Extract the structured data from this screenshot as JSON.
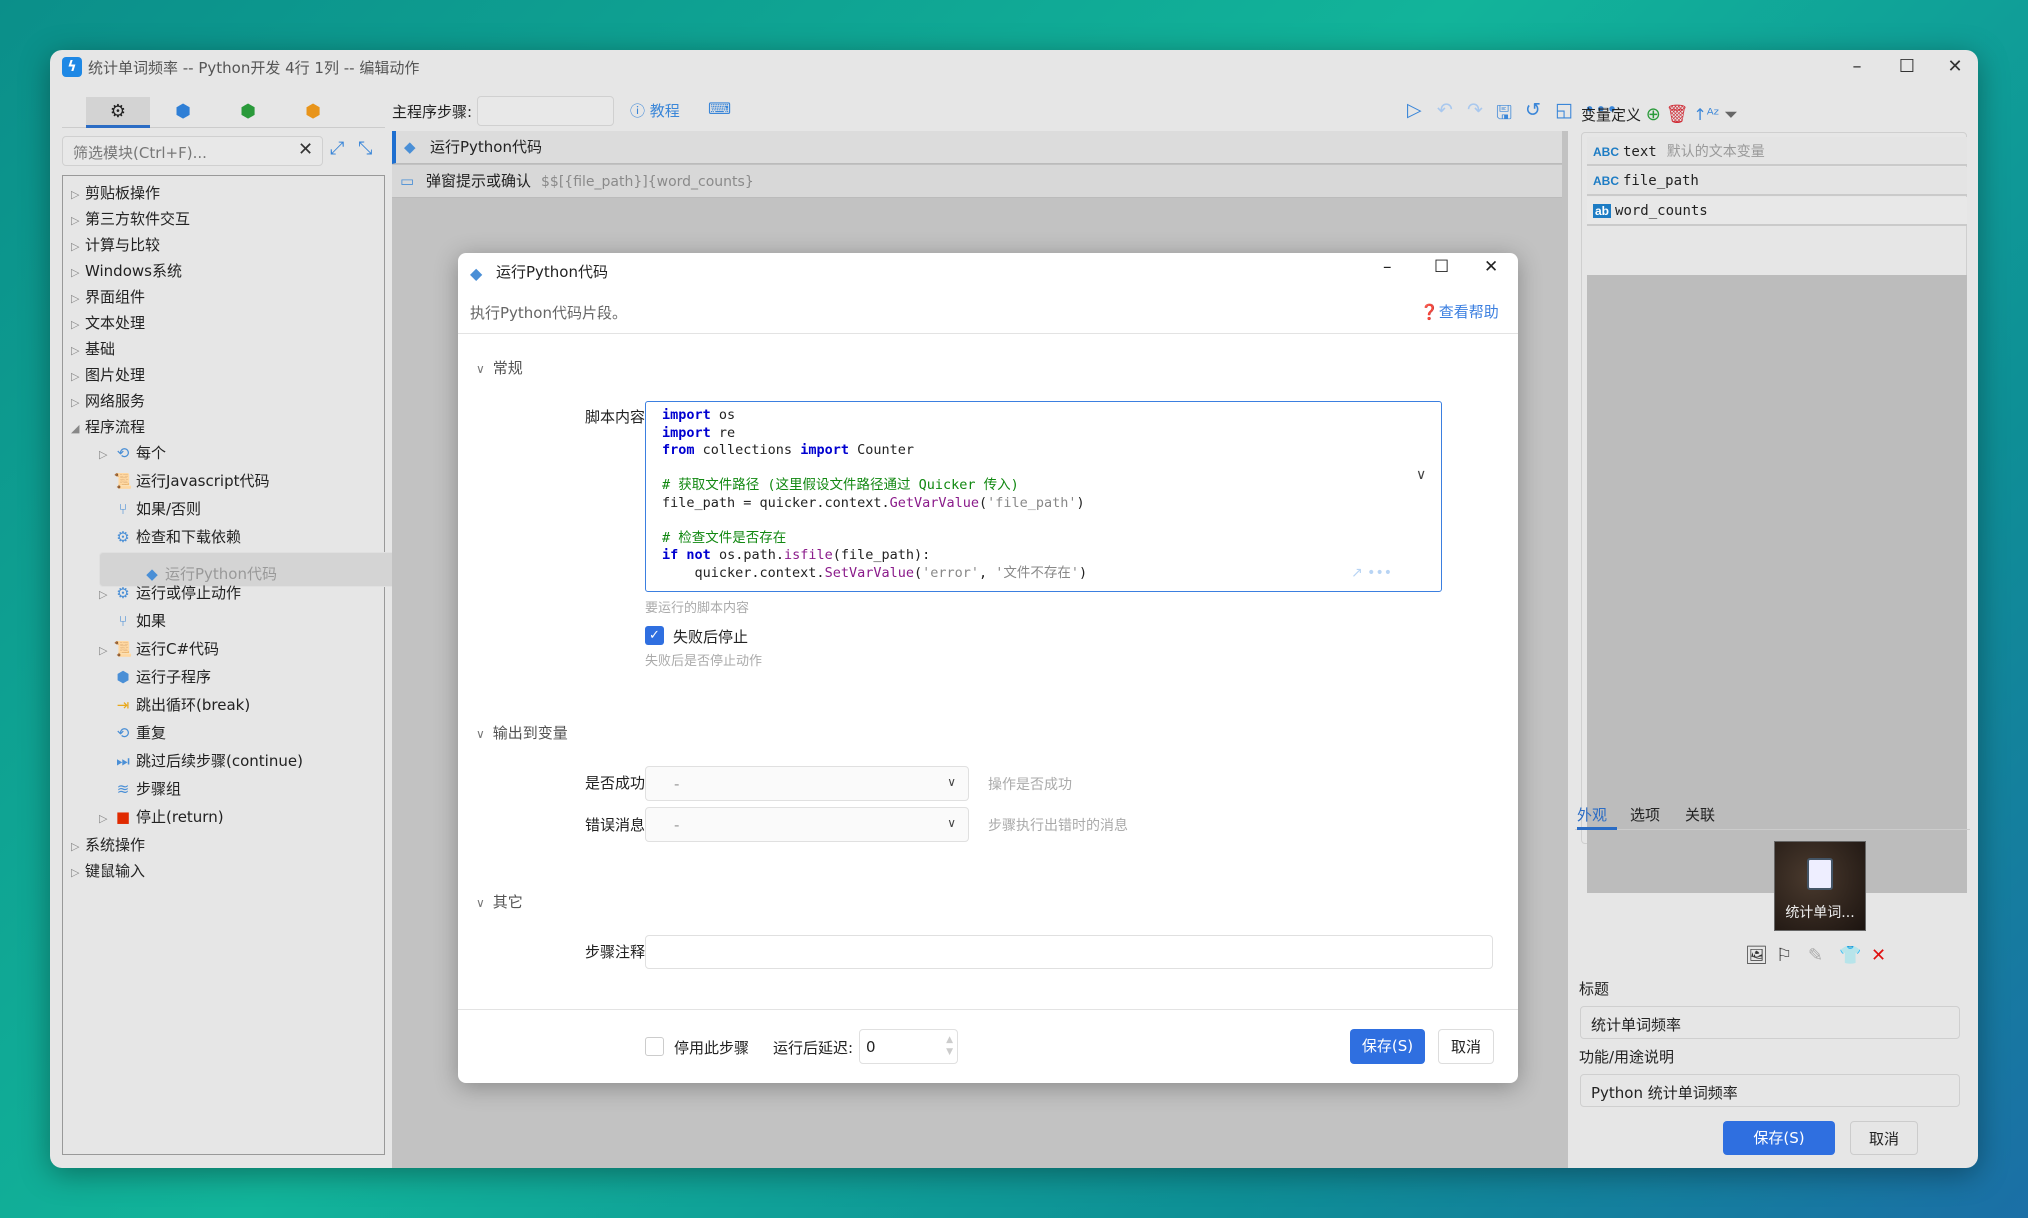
{
  "window": {
    "title": "统计单词频率 -- Python开发 4行 1列 -- 编辑动作",
    "minimize": "–",
    "maximize": "☐",
    "close": "✕"
  },
  "left": {
    "tabs": [
      {
        "icon": "gears-icon",
        "glyph": "⚙",
        "color": "#222"
      },
      {
        "icon": "cubes-blue-icon",
        "glyph": "⬢",
        "color": "#2f7fd6"
      },
      {
        "icon": "cubes-green-icon",
        "glyph": "⬢",
        "color": "#2a9a3a"
      },
      {
        "icon": "cubes-orange-icon",
        "glyph": "⬢",
        "color": "#e8941a"
      }
    ],
    "filter_placeholder": "筛选模块(Ctrl+F)...",
    "tree": [
      {
        "label": "剪贴板操作",
        "level": 0,
        "exp": "▷"
      },
      {
        "label": "第三方软件交互",
        "level": 0,
        "exp": "▷"
      },
      {
        "label": "计算与比较",
        "level": 0,
        "exp": "▷"
      },
      {
        "label": "Windows系统",
        "level": 0,
        "exp": "▷"
      },
      {
        "label": "界面组件",
        "level": 0,
        "exp": "▷"
      },
      {
        "label": "文本处理",
        "level": 0,
        "exp": "▷"
      },
      {
        "label": "基础",
        "level": 0,
        "exp": "▷"
      },
      {
        "label": "图片处理",
        "level": 0,
        "exp": "▷"
      },
      {
        "label": "网络服务",
        "level": 0,
        "exp": "▷"
      },
      {
        "label": "程序流程",
        "level": 0,
        "exp": "◢"
      },
      {
        "label": "每个",
        "level": 1,
        "exp": "▷",
        "icon": "loop-icon",
        "glyph": "⟲"
      },
      {
        "label": "运行Javascript代码",
        "level": 1,
        "exp": "",
        "icon": "script-icon",
        "glyph": "📜"
      },
      {
        "label": "如果/否则",
        "level": 1,
        "exp": "",
        "icon": "branch-icon",
        "glyph": "⑂"
      },
      {
        "label": "检查和下载依赖",
        "level": 1,
        "exp": "",
        "icon": "gear-icon",
        "glyph": "⚙"
      },
      {
        "label": "运行Python代码",
        "level": 1,
        "exp": "",
        "icon": "python-icon",
        "glyph": "◆",
        "selected": true
      },
      {
        "label": "运行或停止动作",
        "level": 1,
        "exp": "▷",
        "icon": "gear-icon",
        "glyph": "⚙"
      },
      {
        "label": "如果",
        "level": 1,
        "exp": "",
        "icon": "branch-icon",
        "glyph": "⑂"
      },
      {
        "label": "运行C#代码",
        "level": 1,
        "exp": "▷",
        "icon": "script-icon",
        "glyph": "📜"
      },
      {
        "label": "运行子程序",
        "level": 1,
        "exp": "",
        "icon": "cubes-icon",
        "glyph": "⬢"
      },
      {
        "label": "跳出循环(break)",
        "level": 1,
        "exp": "",
        "icon": "exit-icon",
        "glyph": "⇥",
        "color": "#e8a81a"
      },
      {
        "label": "重复",
        "level": 1,
        "exp": "",
        "icon": "loop-icon",
        "glyph": "⟲"
      },
      {
        "label": "跳过后续步骤(continue)",
        "level": 1,
        "exp": "",
        "icon": "skip-icon",
        "glyph": "⏭"
      },
      {
        "label": "步骤组",
        "level": 1,
        "exp": "",
        "icon": "layers-icon",
        "glyph": "≋"
      },
      {
        "label": "停止(return)",
        "level": 1,
        "exp": "▷",
        "icon": "stop-icon",
        "glyph": "■",
        "color": "#e02a00"
      },
      {
        "label": "系统操作",
        "level": 0,
        "exp": "▷"
      },
      {
        "label": "键鼠输入",
        "level": 0,
        "exp": "▷"
      }
    ]
  },
  "toolbar": {
    "main_steps_label": "主程序步骤:",
    "tutorial": "教程",
    "icons": [
      "play-icon",
      "undo-icon",
      "redo-icon",
      "save-icon",
      "history-icon",
      "note-icon",
      "more-icon"
    ]
  },
  "steps": [
    {
      "label": "运行Python代码",
      "sub": ""
    },
    {
      "label": "弹窗提示或确认",
      "sub": "$$[{file_path}]{word_counts}"
    }
  ],
  "variables": {
    "header": "变量定义",
    "items": [
      {
        "type": "ABC",
        "name": "text",
        "desc": "默认的文本变量"
      },
      {
        "type": "ABC",
        "name": "file_path",
        "desc": ""
      },
      {
        "type": "ab",
        "name": "word_counts",
        "desc": ""
      }
    ]
  },
  "props": {
    "tabs": [
      "外观",
      "选项",
      "关联"
    ],
    "active_tab": "外观",
    "icon_caption": "统计单词...",
    "title_label": "标题",
    "title_value": "统计单词频率",
    "desc_label": "功能/用途说明",
    "desc_value": "Python 统计单词频率",
    "save": "保存(S)",
    "cancel": "取消"
  },
  "dialog": {
    "title": "运行Python代码",
    "description": "执行Python代码片段。",
    "help": "查看帮助",
    "sections": {
      "general": "常规",
      "output": "输出到变量",
      "other": "其它"
    },
    "script_label": "脚本内容",
    "script_hint": "要运行的脚本内容",
    "code": [
      [
        [
          "kw",
          "import"
        ],
        [
          "",
          "os"
        ]
      ],
      [
        [
          "kw",
          "import"
        ],
        [
          "",
          "re"
        ]
      ],
      [
        [
          "kw",
          "from"
        ],
        [
          "",
          "collections "
        ],
        [
          "kw",
          "import"
        ],
        [
          "",
          "Counter"
        ]
      ],
      [],
      [
        [
          "cm",
          "# 获取文件路径 (这里假设文件路径通过 Quicker 传入)"
        ]
      ],
      [
        [
          "",
          "file_path = quicker.context."
        ],
        [
          "fn",
          "GetVarValue"
        ],
        [
          "",
          "("
        ],
        [
          "st",
          "'file_path'"
        ],
        [
          "",
          ")"
        ]
      ],
      [],
      [
        [
          "cm",
          "# 检查文件是否存在"
        ]
      ],
      [
        [
          "kw",
          "if"
        ],
        [
          "kw",
          "not"
        ],
        [
          "",
          "os.path."
        ],
        [
          "fn",
          "isfile"
        ],
        [
          "",
          "(file_path):"
        ]
      ],
      [
        [
          "",
          "    quicker.context."
        ],
        [
          "fn",
          "SetVarValue"
        ],
        [
          "",
          "("
        ],
        [
          "st",
          "'error'"
        ],
        [
          "",
          ", "
        ],
        [
          "st",
          "'文件不存在'"
        ],
        [
          "",
          ")"
        ]
      ]
    ],
    "stop_on_fail": {
      "label": "失败后停止",
      "checked": true,
      "hint": "失败后是否停止动作"
    },
    "success_label": "是否成功",
    "success_value": "-",
    "success_hint": "操作是否成功",
    "error_label": "错误消息",
    "error_value": "-",
    "error_hint": "步骤执行出错时的消息",
    "note_label": "步骤注释",
    "note_value": "",
    "disable_label": "停用此步骤",
    "disable_checked": false,
    "delay_label": "运行后延迟:",
    "delay_value": "0",
    "save": "保存(S)",
    "cancel": "取消"
  }
}
